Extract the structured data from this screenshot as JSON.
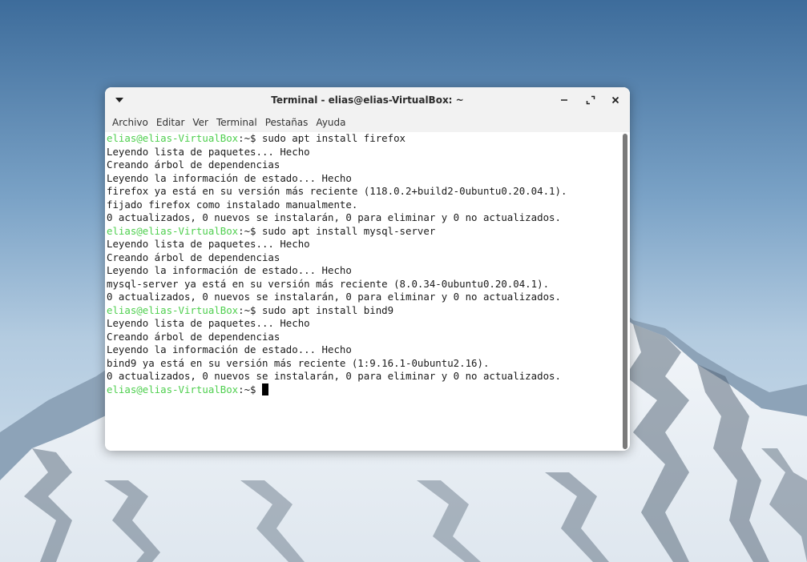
{
  "window": {
    "title": "Terminal - elias@elias-VirtualBox: ~"
  },
  "menubar": {
    "items": [
      "Archivo",
      "Editar",
      "Ver",
      "Terminal",
      "Pestañas",
      "Ayuda"
    ]
  },
  "terminal": {
    "prompt_user": "elias@elias-VirtualBox",
    "prompt_path": ":~$",
    "lines": [
      {
        "type": "prompt",
        "command": " sudo apt install firefox"
      },
      {
        "type": "output",
        "text": "Leyendo lista de paquetes... Hecho"
      },
      {
        "type": "output",
        "text": "Creando árbol de dependencias"
      },
      {
        "type": "output",
        "text": "Leyendo la información de estado... Hecho"
      },
      {
        "type": "output",
        "text": "firefox ya está en su versión más reciente (118.0.2+build2-0ubuntu0.20.04.1)."
      },
      {
        "type": "output",
        "text": "fijado firefox como instalado manualmente."
      },
      {
        "type": "output",
        "text": "0 actualizados, 0 nuevos se instalarán, 0 para eliminar y 0 no actualizados."
      },
      {
        "type": "prompt",
        "command": " sudo apt install mysql-server"
      },
      {
        "type": "output",
        "text": "Leyendo lista de paquetes... Hecho"
      },
      {
        "type": "output",
        "text": "Creando árbol de dependencias"
      },
      {
        "type": "output",
        "text": "Leyendo la información de estado... Hecho"
      },
      {
        "type": "output",
        "text": "mysql-server ya está en su versión más reciente (8.0.34-0ubuntu0.20.04.1)."
      },
      {
        "type": "output",
        "text": "0 actualizados, 0 nuevos se instalarán, 0 para eliminar y 0 no actualizados."
      },
      {
        "type": "prompt",
        "command": " sudo apt install bind9"
      },
      {
        "type": "output",
        "text": "Leyendo lista de paquetes... Hecho"
      },
      {
        "type": "output",
        "text": "Creando árbol de dependencias"
      },
      {
        "type": "output",
        "text": "Leyendo la información de estado... Hecho"
      },
      {
        "type": "output",
        "text": "bind9 ya está en su versión más reciente (1:9.16.1-0ubuntu2.16)."
      },
      {
        "type": "output",
        "text": "0 actualizados, 0 nuevos se instalarán, 0 para eliminar y 0 no actualizados."
      },
      {
        "type": "prompt",
        "command": " ",
        "cursor": true
      }
    ]
  },
  "colors": {
    "prompt_user": "#4ecf4e",
    "text": "#1a1a1a",
    "window_bg": "#ffffff",
    "titlebar_bg": "#f2f2f2"
  },
  "icons": {
    "window_menu": "triangle-down-icon",
    "minimize": "minimize-icon",
    "maximize": "maximize-icon",
    "close": "close-icon"
  }
}
